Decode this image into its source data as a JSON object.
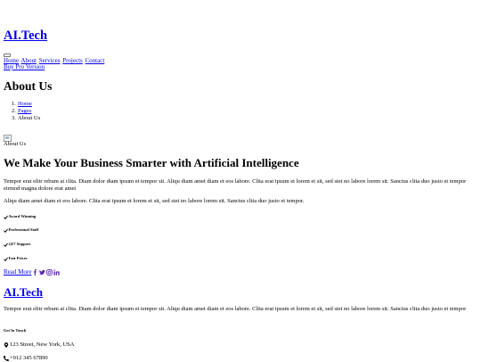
{
  "header": {
    "brand": "AI.Tech"
  },
  "nav": {
    "items": [
      "Home",
      "About",
      "Services",
      "Projects",
      "Contact"
    ],
    "cta": "Buy Pro Version"
  },
  "page_header": {
    "title": "About Us",
    "breadcrumbs": [
      "Home",
      "Pages",
      "About Us"
    ]
  },
  "about": {
    "subtitle": "About Us",
    "heading": "We Make Your Business Smarter with Artificial Intelligence",
    "paragraph1": "Tempor erat elitr rebum at clita. Diam dolor diam ipsum et tempor sit. Aliqu diam amet diam et eos labore. Clita erat ipsum et lorem et sit, sed stet no labore lorem sit. Sanctus clita duo justo et tempor eirmod magna dolore erat amet",
    "paragraph2": "Aliqu diam amet diam et eos labore. Clita erat ipsum et lorem et sit, sed stet no labore lorem sit. Sanctus clita duo justo et tempor.",
    "features": [
      "Award Winning",
      "Professional Staff",
      "24/7 Support",
      "Fair Prices"
    ],
    "read_more": "Read More",
    "social_icons": [
      "facebook-icon",
      "twitter-icon",
      "instagram-icon",
      "linkedin-icon"
    ]
  },
  "footer": {
    "brand": "AI.Tech",
    "paragraph": "Tempor erat elitr rebum at clita. Diam dolor diam ipsum et tempor sit. Aliqu diam amet diam et eos labore. Clita erat ipsum et lorem et sit, sed stet no labore lorem sit. Sanctus clita duo justo et tempor",
    "get_in_touch": "Get In Touch",
    "address": "123 Street, New York, USA",
    "phone": "+012 345 67890"
  },
  "colors": {
    "link": "#0000ee",
    "text": "#000000",
    "social_icon": "#5b2ab3"
  }
}
